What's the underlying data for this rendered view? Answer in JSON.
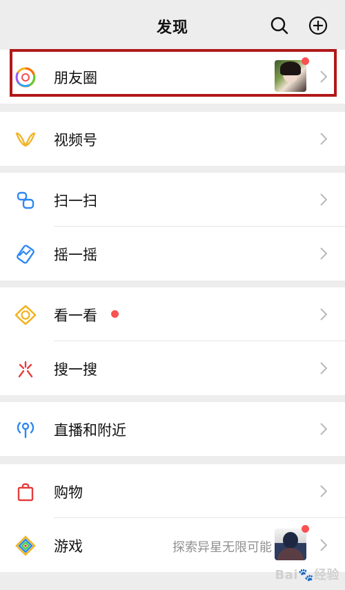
{
  "header": {
    "title": "发现",
    "actions": [
      {
        "name": "search-icon"
      },
      {
        "name": "add-icon"
      }
    ]
  },
  "groups": [
    {
      "items": [
        {
          "label": "朋友圈",
          "icon": "moments-icon",
          "has_dot": true
        }
      ]
    },
    {
      "items": [
        {
          "label": "视频号",
          "icon": "channels-icon"
        }
      ]
    },
    {
      "items": [
        {
          "label": "扫一扫",
          "icon": "scan-icon"
        },
        {
          "label": "摇一摇",
          "icon": "shake-icon"
        }
      ]
    },
    {
      "items": [
        {
          "label": "看一看",
          "icon": "top-stories-icon",
          "has_dot": true
        },
        {
          "label": "搜一搜",
          "icon": "search-icon"
        }
      ]
    },
    {
      "items": [
        {
          "label": "直播和附近",
          "icon": "live-nearby-icon"
        }
      ]
    },
    {
      "items": [
        {
          "label": "购物",
          "icon": "shopping-icon"
        },
        {
          "label": "游戏",
          "icon": "game-icon",
          "subtitle": "探索异星无限可能",
          "has_dot": true
        }
      ]
    }
  ],
  "watermark": "Bai🐾经验"
}
